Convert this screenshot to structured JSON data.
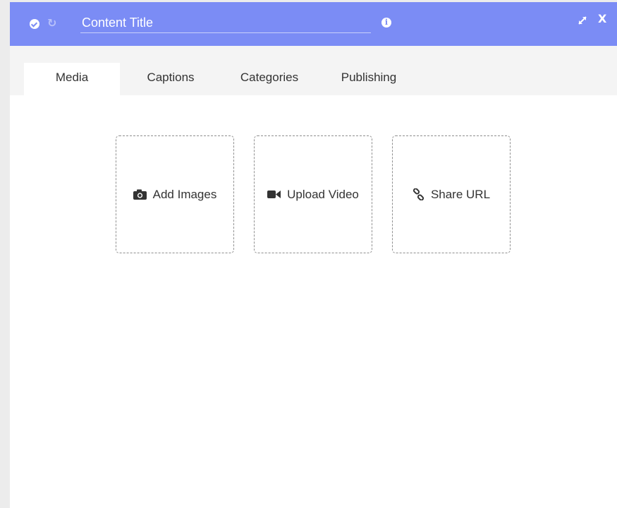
{
  "header": {
    "title_placeholder": "Content Title",
    "accent_color": "#7b8cf5",
    "icons": [
      "check-circle-icon",
      "refresh-icon",
      "info-icon",
      "expand-icon",
      "close-icon"
    ],
    "close_label": "X"
  },
  "tabs": [
    {
      "label": "Media",
      "active": true
    },
    {
      "label": "Captions",
      "active": false
    },
    {
      "label": "Categories",
      "active": false
    },
    {
      "label": "Publishing",
      "active": false
    }
  ],
  "media_options": [
    {
      "label": "Add Images",
      "icon": "camera-icon"
    },
    {
      "label": "Upload Video",
      "icon": "video-camera-icon"
    },
    {
      "label": "Share URL",
      "icon": "link-icon"
    }
  ]
}
